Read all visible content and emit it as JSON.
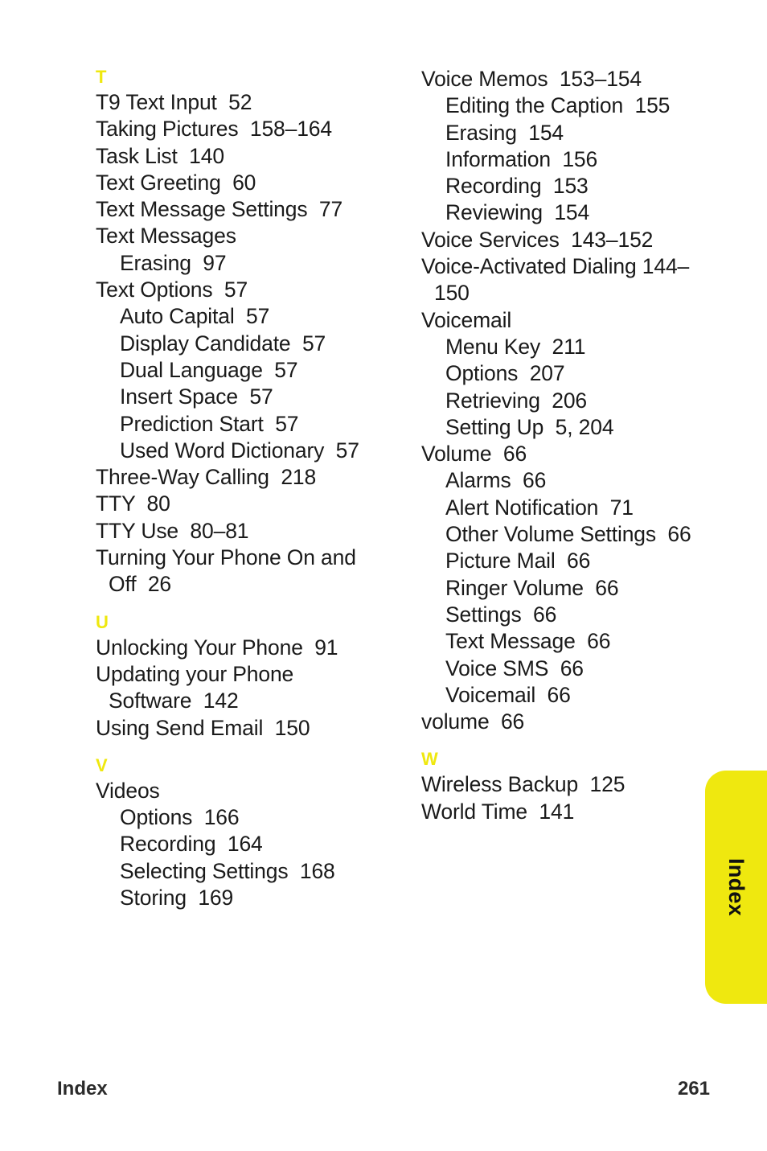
{
  "page": {
    "footer_label": "Index",
    "footer_page_number": "261",
    "side_tab_label": "Index",
    "accent_color": "#efe80f"
  },
  "columns": [
    {
      "id": "left",
      "sections": [
        {
          "letter": "T",
          "entries": [
            {
              "level": 1,
              "text": "T9 Text Input  52"
            },
            {
              "level": 1,
              "text": "Taking Pictures  158–164"
            },
            {
              "level": 1,
              "text": "Task List  140"
            },
            {
              "level": 1,
              "text": "Text Greeting  60"
            },
            {
              "level": 1,
              "text": "Text Message Settings  77"
            },
            {
              "level": 1,
              "text": "Text Messages"
            },
            {
              "level": 2,
              "text": "Erasing  97"
            },
            {
              "level": 1,
              "text": "Text Options  57"
            },
            {
              "level": 2,
              "text": "Auto Capital  57"
            },
            {
              "level": 2,
              "text": "Display Candidate  57"
            },
            {
              "level": 2,
              "text": "Dual Language  57"
            },
            {
              "level": 2,
              "text": "Insert Space  57"
            },
            {
              "level": 2,
              "text": "Prediction Start  57"
            },
            {
              "level": 2,
              "text": "Used Word Dictionary  57"
            },
            {
              "level": 1,
              "text": "Three-Way Calling  218"
            },
            {
              "level": 1,
              "text": "TTY  80"
            },
            {
              "level": 1,
              "text": "TTY Use  80–81"
            },
            {
              "level": 1,
              "wrap": true,
              "text": "Turning Your Phone On and Off  26"
            }
          ]
        },
        {
          "letter": "U",
          "entries": [
            {
              "level": 1,
              "text": "Unlocking Your Phone  91"
            },
            {
              "level": 1,
              "wrap": true,
              "text": "Updating your Phone Software  142"
            },
            {
              "level": 1,
              "text": "Using Send Email  150"
            }
          ]
        },
        {
          "letter": "V",
          "entries": [
            {
              "level": 1,
              "text": "Videos"
            },
            {
              "level": 2,
              "text": "Options  166"
            },
            {
              "level": 2,
              "text": "Recording  164"
            },
            {
              "level": 2,
              "text": "Selecting Settings  168"
            },
            {
              "level": 2,
              "text": "Storing  169"
            }
          ]
        }
      ]
    },
    {
      "id": "right",
      "sections": [
        {
          "letter": "",
          "entries": [
            {
              "level": 1,
              "text": "Voice Memos  153–154"
            },
            {
              "level": 2,
              "text": "Editing the Caption  155"
            },
            {
              "level": 2,
              "text": "Erasing  154"
            },
            {
              "level": 2,
              "text": "Information  156"
            },
            {
              "level": 2,
              "text": "Recording  153"
            },
            {
              "level": 2,
              "text": "Reviewing  154"
            },
            {
              "level": 1,
              "text": "Voice Services  143–152"
            },
            {
              "level": 1,
              "wrap": true,
              "text": "Voice-Activated Dialing 144–150"
            },
            {
              "level": 1,
              "text": "Voicemail"
            },
            {
              "level": 2,
              "text": "Menu Key  211"
            },
            {
              "level": 2,
              "text": "Options  207"
            },
            {
              "level": 2,
              "text": "Retrieving  206"
            },
            {
              "level": 2,
              "text": "Setting Up  5, 204"
            },
            {
              "level": 1,
              "text": "Volume  66"
            },
            {
              "level": 2,
              "text": "Alarms  66"
            },
            {
              "level": 2,
              "text": "Alert Notification  71"
            },
            {
              "level": 2,
              "text": "Other Volume Settings  66"
            },
            {
              "level": 2,
              "text": "Picture Mail  66"
            },
            {
              "level": 2,
              "text": "Ringer Volume  66"
            },
            {
              "level": 2,
              "text": "Settings  66"
            },
            {
              "level": 2,
              "text": "Text Message  66"
            },
            {
              "level": 2,
              "text": "Voice SMS  66"
            },
            {
              "level": 2,
              "text": "Voicemail  66"
            },
            {
              "level": 1,
              "text": "volume  66"
            }
          ]
        },
        {
          "letter": "W",
          "entries": [
            {
              "level": 1,
              "text": "Wireless Backup  125"
            },
            {
              "level": 1,
              "text": "World Time  141"
            }
          ]
        }
      ]
    }
  ]
}
